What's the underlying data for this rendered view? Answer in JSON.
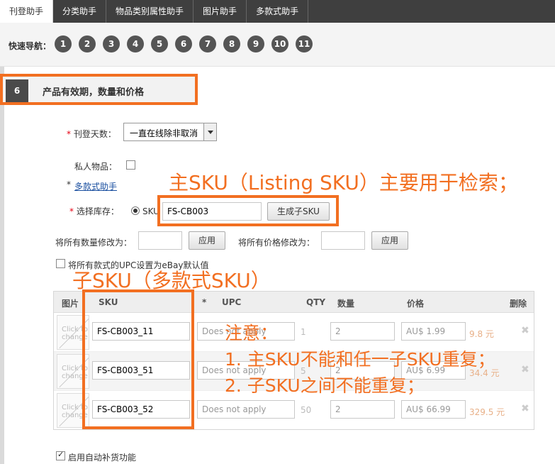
{
  "tabs": [
    {
      "label": "刊登助手",
      "active": true
    },
    {
      "label": "分类助手",
      "active": false
    },
    {
      "label": "物品类别属性助手",
      "active": false
    },
    {
      "label": "图片助手",
      "active": false
    },
    {
      "label": "多款式助手",
      "active": false
    }
  ],
  "quick_nav": {
    "label": "快速导航：",
    "numbers": [
      "1",
      "2",
      "3",
      "4",
      "5",
      "6",
      "7",
      "8",
      "9",
      "10",
      "11"
    ]
  },
  "section": {
    "number": "6",
    "title": "产品有效期，数量和价格"
  },
  "form": {
    "duration_label": "刊登天数：",
    "duration_value": "一直在线除非取消",
    "private_label": "私人物品：",
    "variation_link": "多款式助手",
    "inventory_label": "选择库存：",
    "sku_radio_label": "SKU",
    "main_sku_value": "FS-CB003",
    "generate_button": "生成子SKU",
    "qty_all_label": "将所有数量修改为：",
    "apply_button": "应用",
    "price_all_label": "将所有价格修改为：",
    "upc_default_label": "将所有款式的UPC设置为eBay默认值",
    "auto_restock_label": "启用自动补货功能"
  },
  "annotations": {
    "main_sku": "主SKU（Listing SKU）主要用于检索；",
    "child_sku": "子SKU（多款式SKU）",
    "note_title": "注意：",
    "note_1": "1. 主SKU不能和任一子SKU重复；",
    "note_2": "2. 子SKU之间不能重复；"
  },
  "grid": {
    "headers": {
      "image": "图片",
      "sku": "SKU",
      "upc": "UPC",
      "qty": "QTY",
      "quantity": "数量",
      "price": "价格",
      "delete": "删除"
    },
    "thumb_text": "Click to change",
    "rows": [
      {
        "sku": "FS-CB003_11",
        "upc": "Does not apply",
        "qty": "1",
        "quantity": "2",
        "price": "AU$ 1.99",
        "rmb": "9.8 元"
      },
      {
        "sku": "FS-CB003_51",
        "upc": "Does not apply",
        "qty": "5",
        "quantity": "2",
        "price": "AU$ 6.99",
        "rmb": "34.4 元"
      },
      {
        "sku": "FS-CB003_52",
        "upc": "Does not apply",
        "qty": "50",
        "quantity": "2",
        "price": "AU$ 66.99",
        "rmb": "329.5 元"
      }
    ]
  },
  "colors": {
    "annotation": "#f26f21",
    "tabbar": "#3f3f3f",
    "required": "#e60012",
    "link": "#1a4fa0"
  },
  "icons": {
    "delete": "close-icon",
    "dropdown": "chevron-down-icon"
  }
}
